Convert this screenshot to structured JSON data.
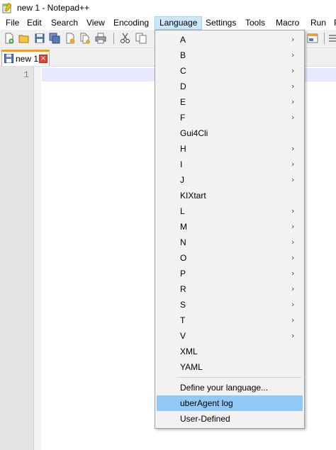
{
  "window": {
    "title": "new 1 - Notepad++"
  },
  "menu": {
    "items": [
      "File",
      "Edit",
      "Search",
      "View",
      "Encoding",
      "Language",
      "Settings",
      "Tools",
      "Macro",
      "Run",
      "P"
    ]
  },
  "tab": {
    "label": "new 1",
    "close": "×"
  },
  "editor": {
    "line_number": "1"
  },
  "language_menu": {
    "items": [
      {
        "label": "A",
        "submenu": "›"
      },
      {
        "label": "B",
        "submenu": "›"
      },
      {
        "label": "C",
        "submenu": "›"
      },
      {
        "label": "D",
        "submenu": "›"
      },
      {
        "label": "E",
        "submenu": "›"
      },
      {
        "label": "F",
        "submenu": "›"
      },
      {
        "label": "Gui4Cli"
      },
      {
        "label": "H",
        "submenu": "›"
      },
      {
        "label": "I",
        "submenu": "›"
      },
      {
        "label": "J",
        "submenu": "›"
      },
      {
        "label": "KIXtart"
      },
      {
        "label": "L",
        "submenu": "›"
      },
      {
        "label": "M",
        "submenu": "›"
      },
      {
        "label": "N",
        "submenu": "›"
      },
      {
        "label": "O",
        "submenu": "›"
      },
      {
        "label": "P",
        "submenu": "›"
      },
      {
        "label": "R",
        "submenu": "›"
      },
      {
        "label": "S",
        "submenu": "›"
      },
      {
        "label": "T",
        "submenu": "›"
      },
      {
        "label": "V",
        "submenu": "›"
      },
      {
        "label": "XML"
      },
      {
        "label": "YAML"
      },
      {
        "label": "Define your language..."
      },
      {
        "label": "uberAgent log"
      },
      {
        "label": "User-Defined"
      }
    ],
    "highlighted": "uberAgent log"
  }
}
